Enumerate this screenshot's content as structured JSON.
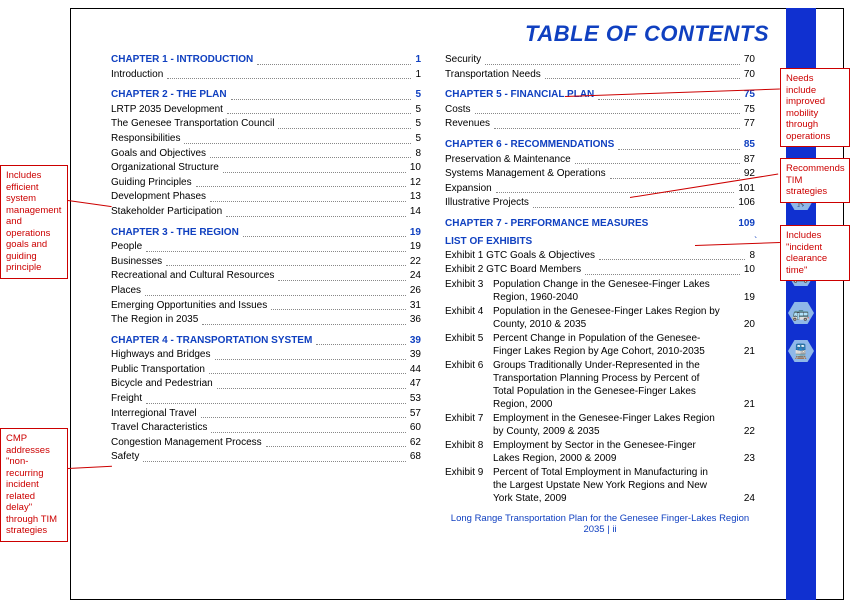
{
  "title": "TABLE OF CONTENTS",
  "footer": "Long Range Transportation Plan for the Genesee Finger-Lakes Region 2035 | ii",
  "col1": [
    {
      "type": "header",
      "label": "CHAPTER 1 - INTRODUCTION",
      "pg": "1"
    },
    {
      "label": "Introduction",
      "pg": "1"
    },
    {
      "type": "space"
    },
    {
      "type": "header",
      "label": "CHAPTER 2 - THE PLAN",
      "pg": "5"
    },
    {
      "label": "LRTP 2035 Development",
      "pg": "5"
    },
    {
      "label": "The Genesee Transportation Council",
      "pg": "5"
    },
    {
      "label": "Responsibilities",
      "pg": "5"
    },
    {
      "label": "Goals and Objectives",
      "pg": "8"
    },
    {
      "label": "Organizational Structure",
      "pg": "10"
    },
    {
      "label": "Guiding Principles",
      "pg": "12"
    },
    {
      "label": "Development Phases",
      "pg": "13"
    },
    {
      "label": "Stakeholder Participation",
      "pg": "14"
    },
    {
      "type": "space"
    },
    {
      "type": "header",
      "label": "CHAPTER 3 - THE REGION",
      "pg": "19"
    },
    {
      "label": "People",
      "pg": "19"
    },
    {
      "label": "Businesses",
      "pg": "22"
    },
    {
      "label": "Recreational and Cultural Resources",
      "pg": "24"
    },
    {
      "label": "Places",
      "pg": "26"
    },
    {
      "label": "Emerging Opportunities and Issues",
      "pg": "31"
    },
    {
      "label": "The Region in 2035",
      "pg": "36"
    },
    {
      "type": "space"
    },
    {
      "type": "header",
      "label": "CHAPTER 4 - TRANSPORTATION SYSTEM",
      "pg": "39"
    },
    {
      "label": "Highways and Bridges",
      "pg": "39"
    },
    {
      "label": "Public Transportation",
      "pg": "44"
    },
    {
      "label": "Bicycle and Pedestrian",
      "pg": "47"
    },
    {
      "label": "Freight",
      "pg": "53"
    },
    {
      "label": "Interregional Travel",
      "pg": "57"
    },
    {
      "label": "Travel Characteristics",
      "pg": "60"
    },
    {
      "label": "Congestion Management Process",
      "pg": "62"
    },
    {
      "label": "Safety",
      "pg": "68"
    }
  ],
  "col2": [
    {
      "label": "Security",
      "pg": "70"
    },
    {
      "label": "Transportation Needs",
      "pg": "70"
    },
    {
      "type": "space"
    },
    {
      "type": "header",
      "label": "CHAPTER 5 - FINANCIAL PLAN",
      "pg": "75"
    },
    {
      "label": "Costs",
      "pg": "75"
    },
    {
      "label": "Revenues",
      "pg": "77"
    },
    {
      "type": "space"
    },
    {
      "type": "header",
      "label": "CHAPTER 6 - RECOMMENDATIONS",
      "pg": "85"
    },
    {
      "label": "Preservation & Maintenance",
      "pg": "87"
    },
    {
      "label": "Systems Management & Operations",
      "pg": "92"
    },
    {
      "label": "Expansion",
      "pg": "101"
    },
    {
      "label": "Illustrative Projects",
      "pg": "106"
    },
    {
      "type": "space"
    },
    {
      "type": "header",
      "label": "CHAPTER 7 - PERFORMANCE MEASURES",
      "pg": "109",
      "no_dots": true
    }
  ],
  "exhibits_heading": "LIST OF EXHIBITS",
  "exhibits": [
    {
      "ex": "Exhibit 1",
      "text": "GTC Goals & Objectives",
      "pg": "8",
      "inline": true
    },
    {
      "ex": "Exhibit 2",
      "text": "GTC Board Members",
      "pg": "10",
      "inline": true
    },
    {
      "ex": "Exhibit 3",
      "text": "Population Change in the Genesee-Finger Lakes Region, 1960-2040",
      "pg": "19"
    },
    {
      "ex": "Exhibit 4",
      "text": "Population in the Genesee-Finger Lakes Region by County, 2010 & 2035",
      "pg": "20"
    },
    {
      "ex": "Exhibit 5",
      "text": "Percent Change in Population of the Genesee-Finger Lakes Region by Age Cohort, 2010-2035",
      "pg": "21"
    },
    {
      "ex": "Exhibit 6",
      "text": "Groups Traditionally Under-Represented in the Transportation Planning Process by Percent of Total Population in the Genesee-Finger Lakes Region, 2000",
      "pg": "21"
    },
    {
      "ex": "Exhibit 7",
      "text": "Employment in the Genesee-Finger Lakes Region by County, 2009 & 2035",
      "pg": "22"
    },
    {
      "ex": "Exhibit 8",
      "text": "Employment by Sector in the Genesee-Finger Lakes Region, 2000 & 2009",
      "pg": "23"
    },
    {
      "ex": "Exhibit 9",
      "text": "Percent of Total Employment in Manufacturing in the Largest Upstate New York Regions and New York State, 2009",
      "pg": "24"
    }
  ],
  "callouts": {
    "left1": "Includes efficient system management and operations goals and guiding principle",
    "left2": "CMP addresses \"non-recurring incident related delay\" through TIM strategies",
    "right1": "Needs include improved mobility through operations",
    "right2": "Recommends TIM strategies",
    "right3": "Includes \"incident clearance time\""
  },
  "icons": [
    "🚶",
    "🚲",
    "🚐",
    "🚌",
    "🚆"
  ]
}
